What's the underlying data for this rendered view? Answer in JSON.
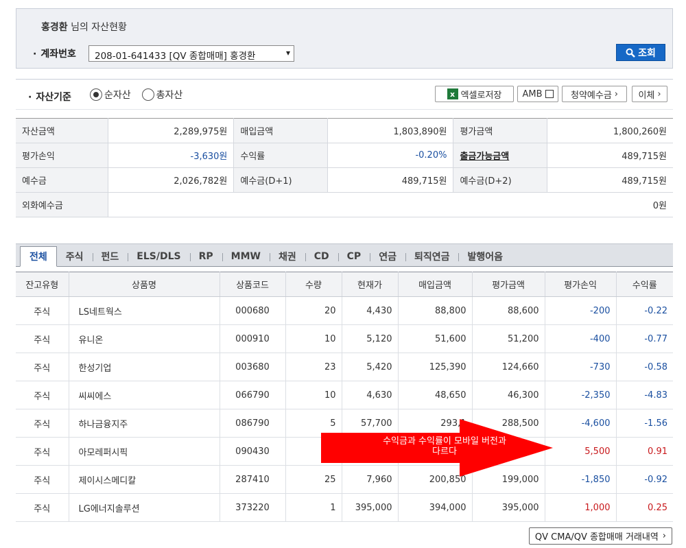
{
  "header": {
    "user_name": "홍경환",
    "title_suffix": "님의 자산현황",
    "account_label": "계좌번호",
    "account_value": "208-01-641433 [QV 종합매매] 홍경환",
    "search_label": "조회"
  },
  "basis": {
    "label": "자산기준",
    "options": [
      "순자산",
      "총자산"
    ],
    "selected": "순자산",
    "excel_label": "엑셀로저장",
    "amb_label": "AMB",
    "subscription_label": "청약예수금",
    "transfer_label": "이체"
  },
  "summary": {
    "rows": [
      [
        {
          "k": "자산금액",
          "v": "2,289,975원"
        },
        {
          "k": "매입금액",
          "v": "1,803,890원"
        },
        {
          "k": "평가금액",
          "v": "1,800,260원"
        }
      ],
      [
        {
          "k": "평가손익",
          "v": "-3,630원"
        },
        {
          "k": "수익률",
          "v": "-0.20%"
        },
        {
          "k": "출금가능금액",
          "v": "489,715원"
        }
      ],
      [
        {
          "k": "예수금",
          "v": "2,026,782원"
        },
        {
          "k": "예수금(D+1)",
          "v": "489,715원"
        },
        {
          "k": "예수금(D+2)",
          "v": "489,715원"
        }
      ]
    ],
    "foreign_label": "외화예수금",
    "foreign_value": "0원"
  },
  "tabs": [
    "전체",
    "주식",
    "펀드",
    "ELS/DLS",
    "RP",
    "MMW",
    "채권",
    "CD",
    "CP",
    "연금",
    "퇴직연금",
    "발행어음"
  ],
  "active_tab": "전체",
  "table": {
    "headers": [
      "잔고유형",
      "상품명",
      "상품코드",
      "수량",
      "현재가",
      "매입금액",
      "평가금액",
      "평가손익",
      "수익률"
    ],
    "rows": [
      [
        "주식",
        "LS네트웍스",
        "000680",
        "20",
        "4,430",
        "88,800",
        "88,600",
        "-200",
        "-0.22"
      ],
      [
        "주식",
        "유니온",
        "000910",
        "10",
        "5,120",
        "51,600",
        "51,200",
        "-400",
        "-0.77"
      ],
      [
        "주식",
        "한성기업",
        "003680",
        "23",
        "5,420",
        "125,390",
        "124,660",
        "-730",
        "-0.58"
      ],
      [
        "주식",
        "씨씨에스",
        "066790",
        "10",
        "4,630",
        "48,650",
        "46,300",
        "-2,350",
        "-4.83"
      ],
      [
        "주식",
        "하나금융지주",
        "086790",
        "5",
        "57,700",
        "293,1",
        "288,500",
        "-4,600",
        "-1.56"
      ],
      [
        "주식",
        "아모레퍼시픽",
        "090430",
        "",
        "",
        "",
        "",
        "5,500",
        "0.91"
      ],
      [
        "주식",
        "제이시스메디칼",
        "287410",
        "25",
        "7,960",
        "200,850",
        "199,000",
        "-1,850",
        "-0.92"
      ],
      [
        "주식",
        "LG에너지솔루션",
        "373220",
        "1",
        "395,000",
        "394,000",
        "395,000",
        "1,000",
        "0.25"
      ]
    ]
  },
  "annotation": {
    "line1": "수익금과 수익률이 모바일 버전과",
    "line2": "다르다",
    "color": "#ff0000"
  },
  "history_label": "QV CMA/QV 종합매매 거래내역"
}
